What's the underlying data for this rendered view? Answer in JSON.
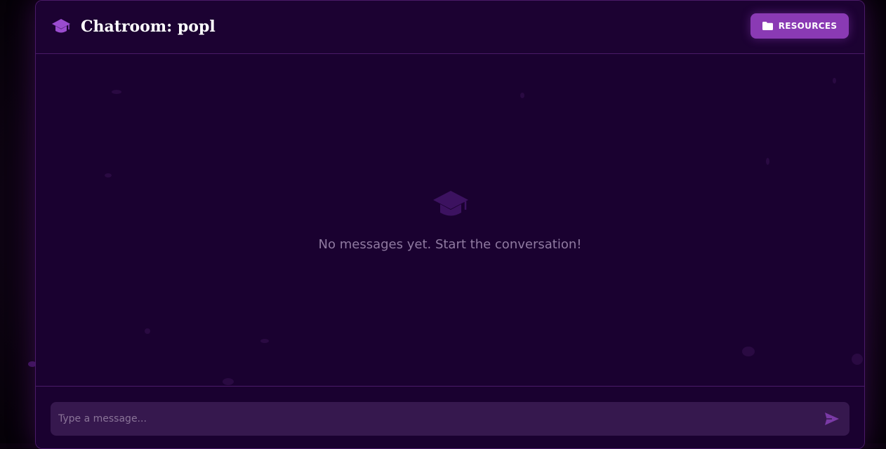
{
  "header": {
    "title": "Chatroom: popl",
    "icon": "graduation-cap-icon",
    "resources_label": "RESOURCES",
    "resources_icon": "folder-icon"
  },
  "messages": {
    "empty_icon": "graduation-cap-icon",
    "empty_text": "No messages yet. Start the conversation!"
  },
  "composer": {
    "placeholder": "Type a message...",
    "value": "",
    "send_icon": "send-icon"
  },
  "colors": {
    "accent": "#8a3ab4",
    "background": "#1a0130",
    "border": "#4a1a68",
    "input_bg": "#36184e"
  }
}
